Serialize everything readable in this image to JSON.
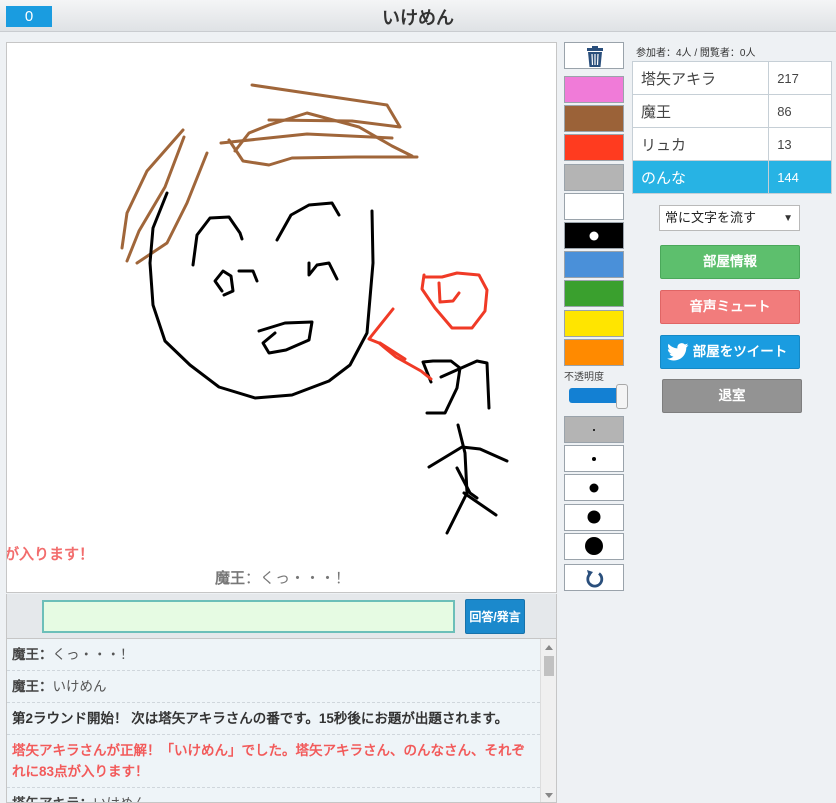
{
  "header": {
    "counter": "0",
    "title": "いけめん"
  },
  "canvas": {
    "flow_text": "点が入ります！",
    "last_message": {
      "name": "魔王",
      "separator": "：",
      "text": "くっ・・・！"
    }
  },
  "answer": {
    "input_value": "",
    "button_label": "回答/発言"
  },
  "chat": [
    {
      "name": "魔王",
      "text": "くっ・・・！",
      "kind": "user"
    },
    {
      "name": "魔王",
      "text": "いけめん",
      "kind": "user"
    },
    {
      "text": "第2ラウンド開始！ 次は塔矢アキラさんの番です。15秒後にお題が出題されます。",
      "kind": "sys"
    },
    {
      "text": "塔矢アキラさんが正解！「いけめん」でした。塔矢アキラさん、のんなさん、それぞれに83点が入ります！",
      "kind": "red"
    },
    {
      "name": "塔矢アキラ",
      "text": "いけめん",
      "kind": "user"
    }
  ],
  "tools": {
    "trash_icon": "trash-icon",
    "colors": [
      "#f07bd8",
      "#9b6238",
      "#ff3b1f",
      "#b4b4b4",
      "#ffffff",
      "#000000",
      "#4a90d9",
      "#3aa02e",
      "#ffe500",
      "#ff8a00"
    ],
    "opacity_label": "不透明度",
    "opacity_value": 1.0,
    "brush_sizes": [
      2,
      4,
      9,
      13,
      18
    ],
    "undo_icon": "undo-icon"
  },
  "sidebar": {
    "participants_label": "参加者：4人 / 閲覧者：0人",
    "scores": [
      {
        "name": "塔矢アキラ",
        "points": "217",
        "active": false
      },
      {
        "name": "魔王",
        "points": "86",
        "active": false
      },
      {
        "name": "リュカ",
        "points": "13",
        "active": false
      },
      {
        "name": "のんな",
        "points": "144",
        "active": true
      }
    ],
    "mode_select": "常に文字を流す",
    "room_info_button": "部屋情報",
    "mute_button": "音声ミュート",
    "tweet_button": "部屋をツイート",
    "exit_button": "退室"
  }
}
